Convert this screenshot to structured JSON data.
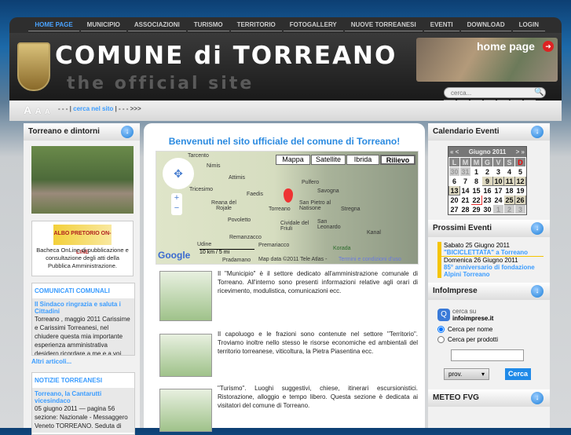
{
  "nav": [
    "HOME PAGE",
    "MUNICIPIO",
    "ASSOCIAZIONI",
    "TURISMO",
    "TERRITORIO",
    "FOTOGALLERY",
    "NUOVE TORREANESI",
    "EVENTI",
    "DOWNLOAD",
    "LOGIN"
  ],
  "header": {
    "title": "COMUNE di TORREANO",
    "subtitle": "the official site",
    "home_page": "home page",
    "search_placeholder": "cerca..."
  },
  "toolbar": {
    "font_sizes": [
      "A",
      "A",
      "A"
    ],
    "prefix": "- - - |",
    "link": "cerca nel sito",
    "suffix": "| - - - >>>"
  },
  "left": {
    "dintorni_title": "Torreano e dintorni",
    "albo": {
      "logo_text": "ALBO PRETORIO ON-LINE",
      "desc": "Bacheca OnLine di pubblicazione e consultazione degli atti della Pubblica Amministrazione."
    },
    "comunicati": {
      "title": "COMUNICATI COMUNALI",
      "headline": "Il Sindaco ringrazia e saluta i Cittadini",
      "text": "Torreano , maggio 2011 Carissime e Carissimi Torreanesi, nel chiudere questa mia importante esperienza amministrativa desidero ricordare a me e a voi...",
      "more": "Altri articoli..."
    },
    "notizie": {
      "title": "NOTIZIE TORREANESI",
      "headline": "Torreano, la Cantarutti vicesindaco",
      "text": "05 giugno 2011 — pagina 56 sezione: Nazionale - Messaggero Veneto TORREANO. Seduta di"
    }
  },
  "center": {
    "title": "Benvenuti nel sito ufficiale del comune di Torreano!",
    "map": {
      "buttons": [
        "Mappa",
        "Satellite",
        "Ibrida",
        "Rilievo"
      ],
      "active": "Rilievo",
      "labels": [
        "Tarcento",
        "Nimis",
        "Attimis",
        "Pulfero",
        "Tricesimo",
        "Faedis",
        "Savogna",
        "Reana del Rojale",
        "Torreano",
        "San Pietro al Natisone",
        "Stregna",
        "Povoletto",
        "Cividale del Friuli",
        "San Leonardo",
        "Remanzacco",
        "Udine",
        "Premariacco",
        "Kanal",
        "Korada",
        "Pradamano"
      ],
      "scale": [
        "10 km",
        "5 mi"
      ],
      "copyright": "Map data ©2011 Tele Atlas -",
      "terms": "Termini e condizioni d'uso",
      "logo": "Google"
    },
    "items": [
      {
        "text": "Il \"Municipio\" è il settore dedicato all'amministrazione comunale di Torreano. All'interno sono presenti informazioni relative agli orari di ricevimento, modulistica, comunicazioni ecc."
      },
      {
        "text": "Il capoluogo e le frazioni sono contenute nel settore \"Territorio\". Troviamo inoltre nello stesso le risorse economiche ed ambientali del territorio torreanese, viticoltura, la Pietra Piasentina ecc."
      },
      {
        "text": "\"Turismo\". Luoghi suggestivi, chiese, itinerari escursionistici. Ristorazione, alloggio e tempo libero. Questa sezione è dedicata ai visitatori del comune di Torreano."
      }
    ]
  },
  "right": {
    "calendar": {
      "title": "Calendario Eventi",
      "month": "Giugno 2011",
      "prev": "« <",
      "next": "> »",
      "days": [
        "L",
        "M",
        "M",
        "G",
        "V",
        "S",
        "D"
      ],
      "weeks": [
        [
          "30",
          "31",
          "1",
          "2",
          "3",
          "4",
          "5"
        ],
        [
          "6",
          "7",
          "8",
          "9",
          "10",
          "11",
          "12"
        ],
        [
          "13",
          "14",
          "15",
          "16",
          "17",
          "18",
          "19"
        ],
        [
          "20",
          "21",
          "22",
          "23",
          "24",
          "25",
          "26"
        ],
        [
          "27",
          "28",
          "29",
          "30",
          "1",
          "2",
          "3"
        ]
      ],
      "event_days": [
        "9",
        "10",
        "11",
        "12",
        "13",
        "25",
        "26"
      ],
      "today": "22"
    },
    "events": {
      "title": "Prossimi Eventi",
      "list": [
        {
          "date": "Sabato 25 Giugno 2011",
          "name": "\"BICICLETTATA\" a Torreano"
        },
        {
          "date": "Domenica 26 Giugno 2011",
          "name": "85° anniversario di fondazione Alpini Torreano"
        }
      ]
    },
    "infoimprese": {
      "title": "InfoImprese",
      "cerca_su": "cerca su",
      "site": "infoimprese.it",
      "options": [
        "Cerca per nome",
        "Cerca per prodotti"
      ],
      "selected": "Cerca per nome",
      "input_value": "",
      "prov": "prov.",
      "button": "Cerca"
    },
    "meteo": {
      "title": "METEO FVG"
    }
  }
}
